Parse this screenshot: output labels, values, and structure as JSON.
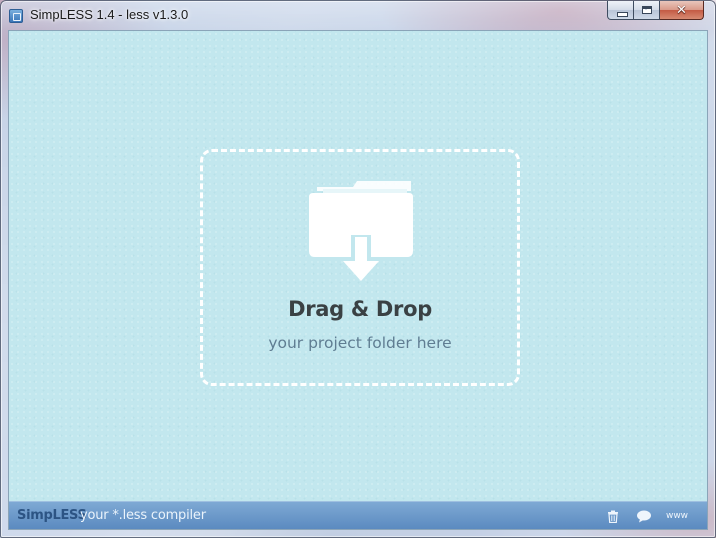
{
  "window": {
    "title": "SimpLESS 1.4 - less v1.3.0",
    "icon": "app-icon",
    "controls": {
      "minimize_icon": "minimize-icon",
      "maximize_icon": "maximize-icon",
      "close_icon": "close-icon",
      "close_glyph": "✕"
    }
  },
  "dropzone": {
    "title": "Drag & Drop",
    "subtitle": "your project folder here",
    "icon": "folder-drop-icon"
  },
  "footer": {
    "brand": "SimpLESS",
    "tagline": "your *.less compiler",
    "buttons": {
      "trash_icon": "trash-icon",
      "comment_icon": "speech-bubble-icon",
      "www_label": "www"
    }
  },
  "colors": {
    "background": "#c2e7ee",
    "dashed_border": "#ffffff",
    "title_text": "#3a4144",
    "subtitle_text": "#5f7d92",
    "footer_bar": "#6a98c9",
    "footer_brand": "#2c5484"
  }
}
